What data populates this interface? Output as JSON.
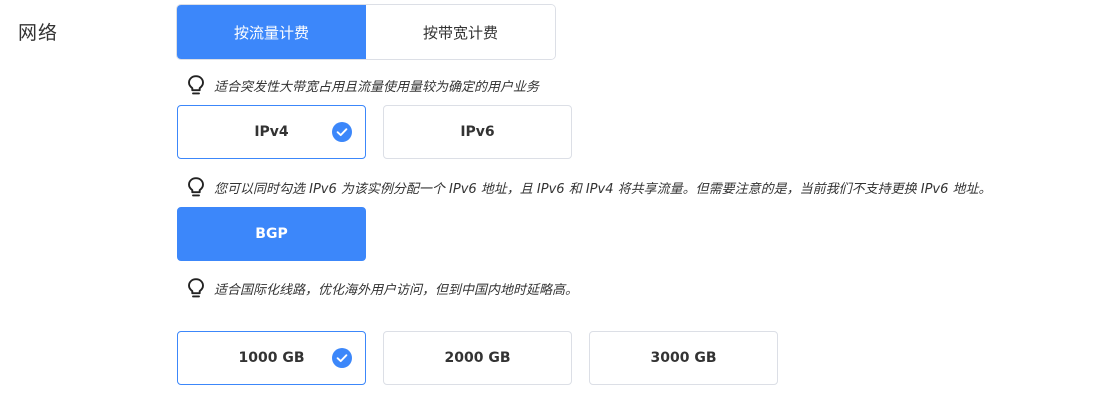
{
  "network": {
    "label": "网络",
    "billing": {
      "options": [
        {
          "label": "按流量计费",
          "active": true
        },
        {
          "label": "按带宽计费",
          "active": false
        }
      ],
      "hint": "适合突发性大带宽占用且流量使用量较为确定的用户业务"
    },
    "ip_version": {
      "options": [
        {
          "label": "IPv4",
          "selected": true
        },
        {
          "label": "IPv6",
          "selected": false
        }
      ],
      "hint": "您可以同时勾选 IPv6 为该实例分配一个 IPv6 地址，且 IPv6 和 IPv4 将共享流量。但需要注意的是，当前我们不支持更换 IPv6 地址。"
    },
    "line": {
      "options": [
        {
          "label": "BGP",
          "selected": true
        }
      ],
      "hint": "适合国际化线路，优化海外用户访问，但到中国内地时延略高。"
    },
    "traffic": {
      "options": [
        {
          "label": "1000 GB",
          "selected": true
        },
        {
          "label": "2000 GB",
          "selected": false
        },
        {
          "label": "3000 GB",
          "selected": false
        }
      ]
    }
  },
  "colors": {
    "accent": "#3c87fa",
    "border": "#dcdfe6",
    "text": "#333333"
  },
  "icons": {
    "hint": "lightbulb-icon",
    "selected": "check-circle-icon"
  }
}
